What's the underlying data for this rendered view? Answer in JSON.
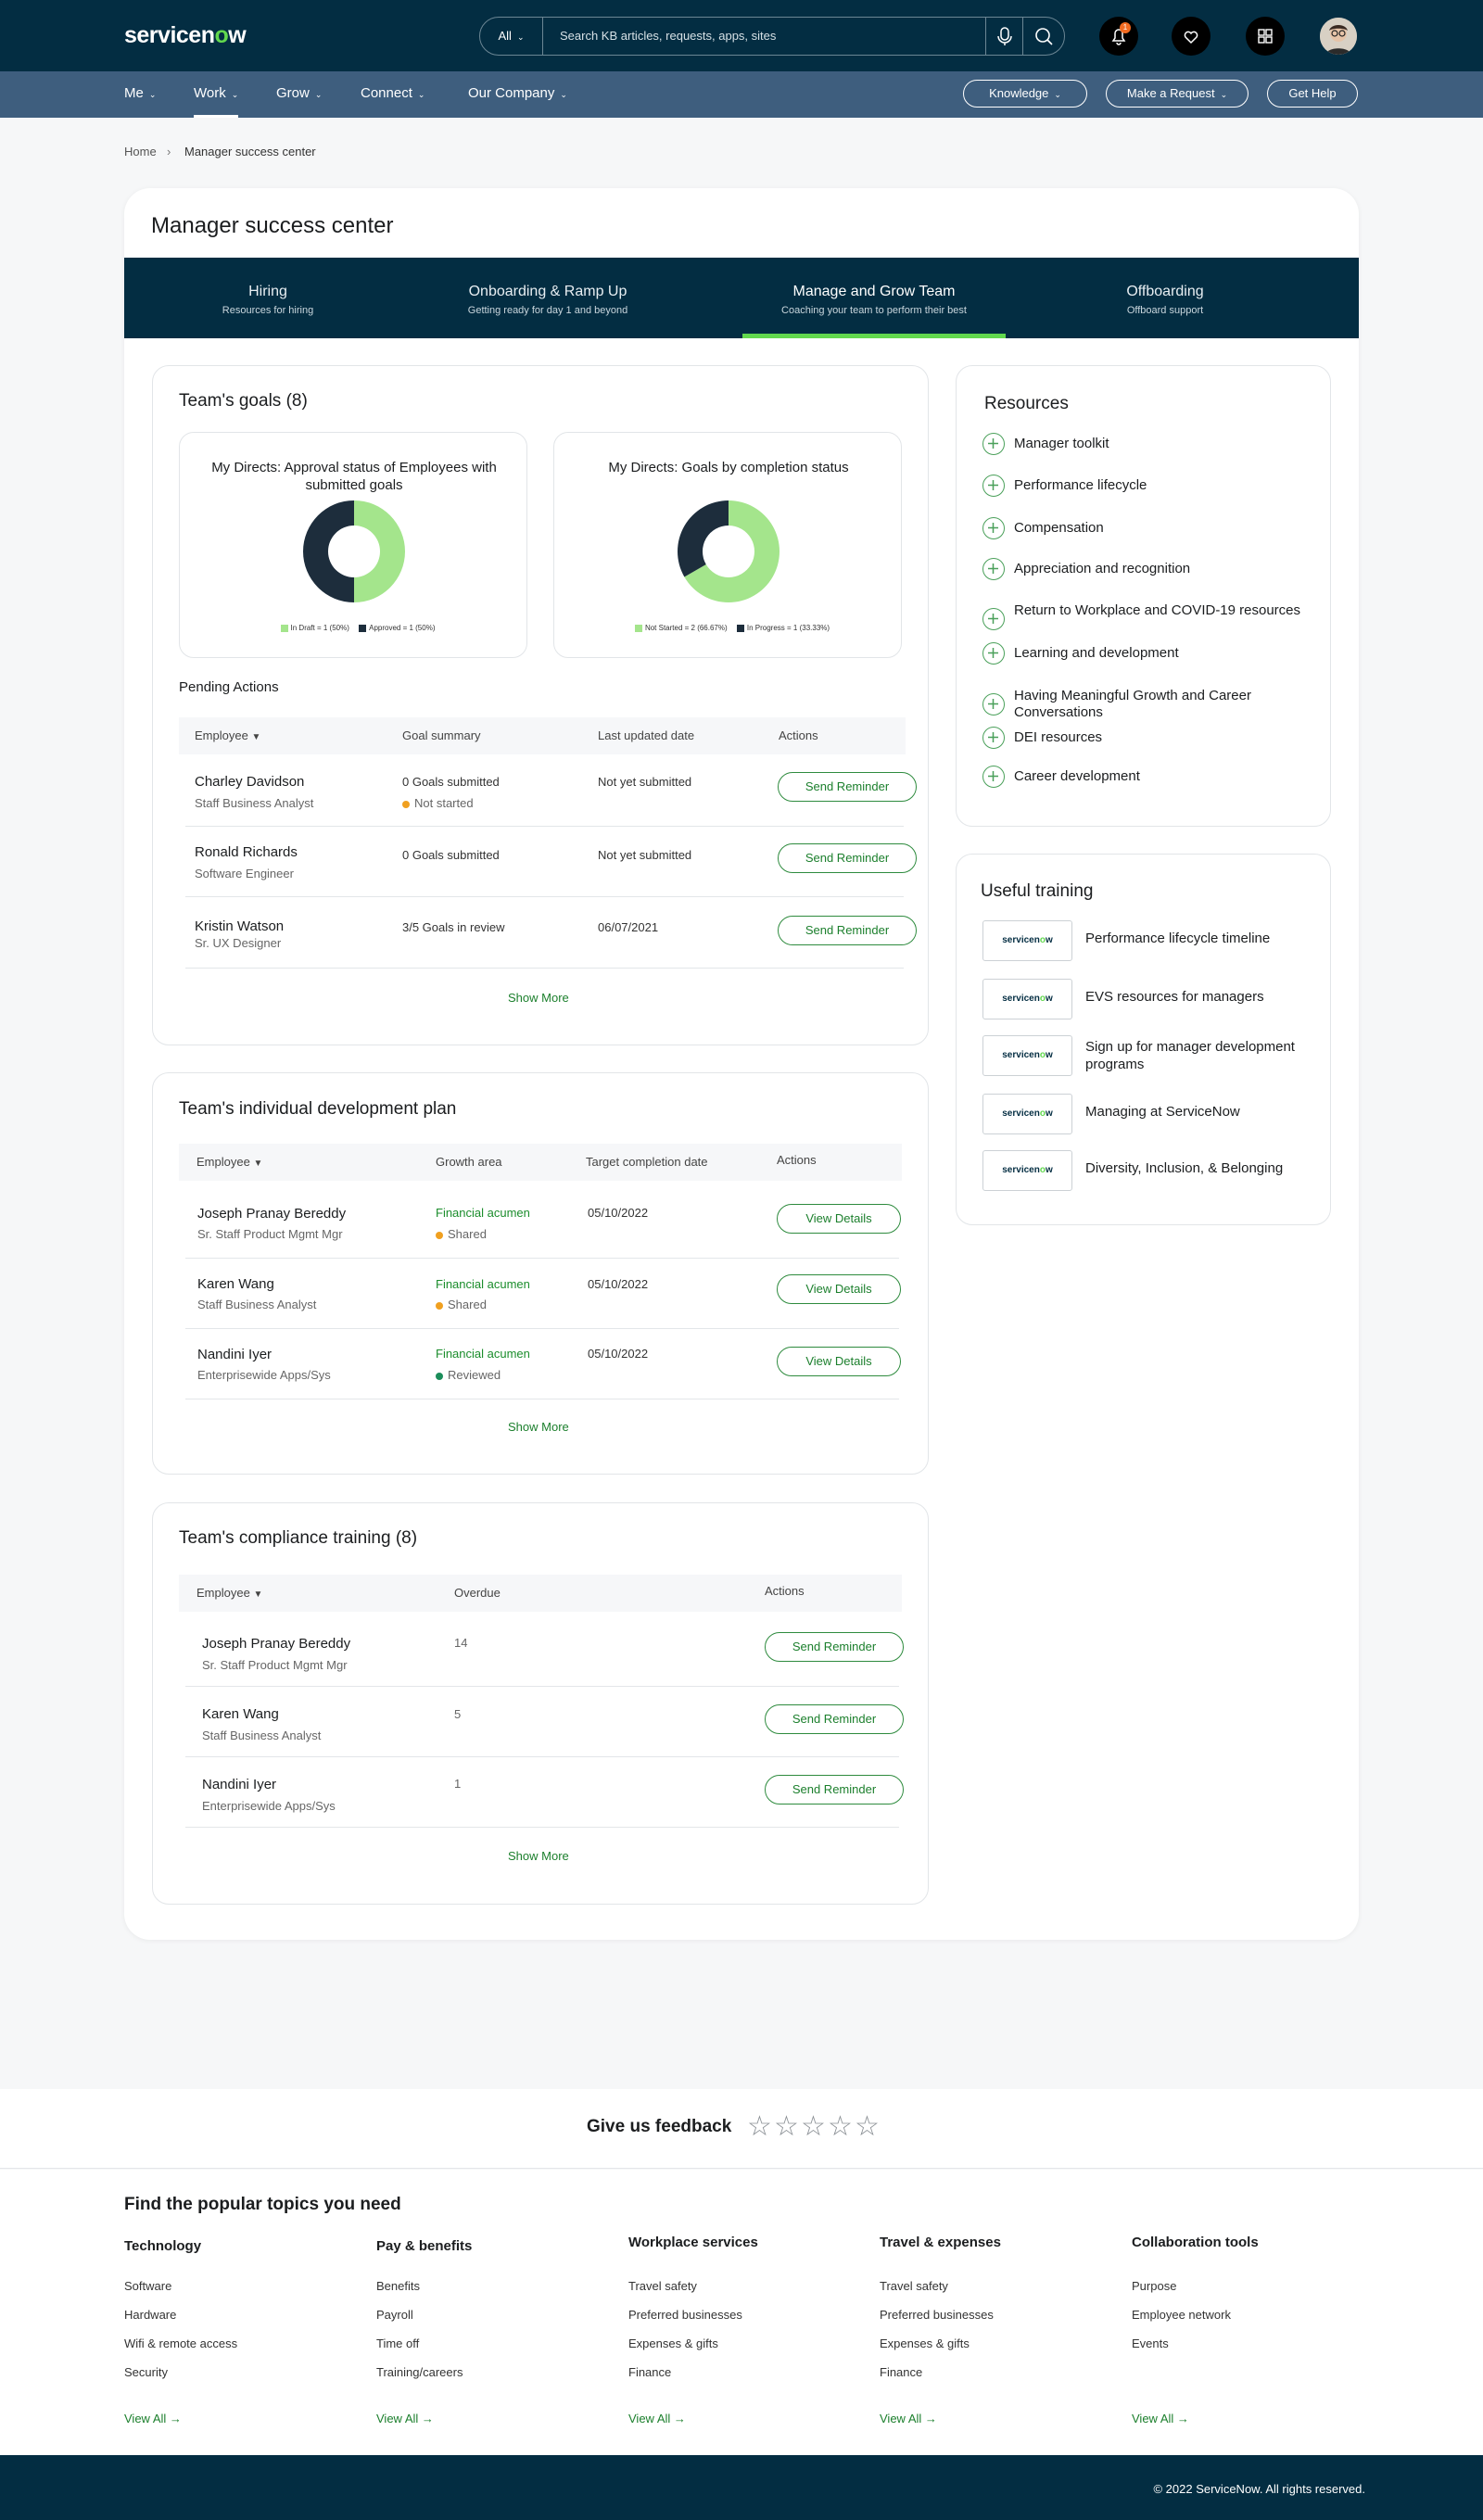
{
  "header": {
    "logo_main": "servicen",
    "logo_o": "o",
    "logo_end": "w",
    "search_scope": "All",
    "search_placeholder": "Search KB articles, requests, apps, sites",
    "notification_count": "1"
  },
  "nav": {
    "items": [
      "Me",
      "Work",
      "Grow",
      "Connect",
      "Our Company"
    ],
    "active": "Work",
    "buttons": {
      "knowledge": "Knowledge",
      "request": "Make a Request",
      "help": "Get Help"
    }
  },
  "breadcrumb": {
    "home": "Home",
    "current": "Manager success center"
  },
  "page_title": "Manager success center",
  "tabs": [
    {
      "title": "Hiring",
      "subtitle": "Resources for hiring"
    },
    {
      "title": "Onboarding & Ramp Up",
      "subtitle": "Getting ready for day 1 and beyond"
    },
    {
      "title": "Manage and Grow Team",
      "subtitle": "Coaching your team to perform their best"
    },
    {
      "title": "Offboarding",
      "subtitle": "Offboard support"
    }
  ],
  "goals": {
    "title": "Team's goals (8)",
    "chart1_title": "My Directs: Approval status of Employees with submitted goals",
    "chart2_title": "My Directs: Goals by completion status",
    "chart1_legend": [
      "In Draft = 1 (50%)",
      "Approved = 1 (50%)"
    ],
    "chart2_legend": [
      "Not Started = 2 (66.67%)",
      "In Progress = 1 (33.33%)"
    ],
    "pending_label": "Pending Actions",
    "headers": [
      "Employee",
      "Goal summary",
      "Last updated date",
      "Actions"
    ],
    "rows": [
      {
        "name": "Charley Davidson",
        "role": "Staff Business Analyst",
        "summary": "0 Goals submitted",
        "status": "Not started",
        "date": "Not yet submitted",
        "action": "Send Reminder"
      },
      {
        "name": "Ronald Richards",
        "role": "Software Engineer",
        "summary": "0 Goals submitted",
        "status": "",
        "date": "Not yet submitted",
        "action": "Send Reminder"
      },
      {
        "name": "Kristin Watson",
        "role": "Sr. UX Designer",
        "summary": "3/5 Goals in review",
        "status": "",
        "date": "06/07/2021",
        "action": "Send Reminder"
      }
    ],
    "show_more": "Show More"
  },
  "chart_data": [
    {
      "type": "pie",
      "title": "My Directs: Approval status of Employees with submitted goals",
      "categories": [
        "In Draft",
        "Approved"
      ],
      "values": [
        1,
        1
      ],
      "colors": [
        "#a4e58c",
        "#1d2d3c"
      ],
      "legend": "bottom"
    },
    {
      "type": "pie",
      "title": "My Directs: Goals by completion status",
      "categories": [
        "Not Started",
        "In Progress"
      ],
      "values": [
        2,
        1
      ],
      "colors": [
        "#a4e58c",
        "#1d2d3c"
      ],
      "legend": "bottom"
    }
  ],
  "idp": {
    "title": "Team's individual development plan",
    "headers": [
      "Employee",
      "Growth area",
      "Target completion date",
      "Actions"
    ],
    "rows": [
      {
        "name": "Joseph Pranay Bereddy",
        "role": "Sr. Staff Product Mgmt Mgr",
        "area": "Financial acumen",
        "status": "Shared",
        "date": "05/10/2022",
        "action": "View Details"
      },
      {
        "name": "Karen Wang",
        "role": "Staff Business Analyst",
        "area": "Financial acumen",
        "status": "Shared",
        "date": "05/10/2022",
        "action": "View Details"
      },
      {
        "name": "Nandini Iyer",
        "role": "Enterprisewide Apps/Sys",
        "area": "Financial acumen",
        "status": "Reviewed",
        "date": "05/10/2022",
        "action": "View Details"
      }
    ],
    "show_more": "Show More"
  },
  "compliance": {
    "title": "Team's compliance training (8)",
    "headers": [
      "Employee",
      "Overdue",
      "Actions"
    ],
    "rows": [
      {
        "name": "Joseph Pranay Bereddy",
        "role": "Sr. Staff Product Mgmt Mgr",
        "overdue": "14",
        "action": "Send Reminder"
      },
      {
        "name": "Karen Wang",
        "role": "Staff Business Analyst",
        "overdue": "5",
        "action": "Send Reminder"
      },
      {
        "name": "Nandini Iyer",
        "role": "Enterprisewide Apps/Sys",
        "overdue": "1",
        "action": "Send Reminder"
      }
    ],
    "show_more": "Show More"
  },
  "resources": {
    "title": "Resources",
    "items": [
      "Manager toolkit",
      "Performance lifecycle",
      "Compensation",
      "Appreciation and recognition",
      "Return to Workplace and COVID-19 resources",
      "Learning and development",
      "Having Meaningful Growth and Career Conversations",
      "DEI resources",
      "Career development"
    ]
  },
  "training": {
    "title": "Useful training",
    "items": [
      "Performance lifecycle timeline",
      "EVS resources for managers",
      "Sign up for manager development programs",
      "Managing at ServiceNow",
      "Diversity, Inclusion, & Belonging"
    ]
  },
  "feedback": {
    "label": "Give us feedback",
    "rating": 0,
    "max": 5
  },
  "footer": {
    "title": "Find the popular topics you need",
    "columns": [
      {
        "heading": "Technology",
        "links": [
          "Software",
          "Hardware",
          "Wifi & remote access",
          "Security"
        ]
      },
      {
        "heading": "Pay & benefits",
        "links": [
          "Benefits",
          "Payroll",
          "Time off",
          "Training/careers"
        ]
      },
      {
        "heading": "Workplace services",
        "links": [
          "Travel safety",
          "Preferred businesses",
          "Expenses & gifts",
          "Finance"
        ]
      },
      {
        "heading": "Travel & expenses",
        "links": [
          "Travel safety",
          "Preferred businesses",
          "Expenses & gifts",
          "Finance"
        ]
      },
      {
        "heading": "Collaboration tools",
        "links": [
          "Purpose",
          "Employee network",
          "Events"
        ]
      }
    ],
    "view_all": "View All",
    "copyright": "© 2022 ServiceNow. All rights reserved."
  },
  "colors": {
    "accent": "#62d84e",
    "navy": "#032d42",
    "link_green": "#1b7f2c",
    "status_orange": "#f0a020",
    "status_green": "#1b8d2c"
  }
}
